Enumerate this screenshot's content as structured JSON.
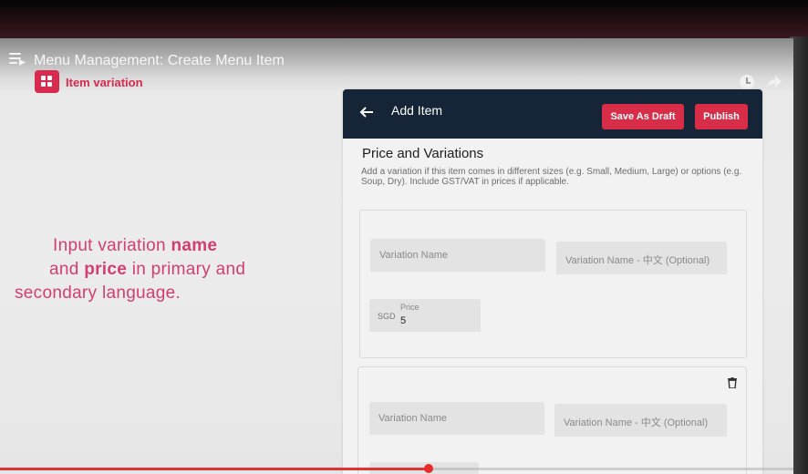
{
  "video": {
    "title": "Menu Management: Create Menu Item",
    "progress_fraction": 0.54
  },
  "brand": {
    "label": "Item variation",
    "accent": "#d8294f"
  },
  "caption": {
    "line1_pre": "Input variation ",
    "line1_bold": "name",
    "line2_pre": "and ",
    "line2_bold": "price",
    "line2_post": " in primary and",
    "line3": "secondary language."
  },
  "card": {
    "title": "Add Item",
    "save_draft_label": "Save As Draft",
    "publish_label": "Publish",
    "section_title": "Price and Variations",
    "section_desc": "Add a variation if this item comes in different sizes (e.g. Small, Medium, Large) or options (e.g. Soup, Dry). Include GST/VAT in prices if applicable.",
    "header_color": "#152436",
    "button_color": "#d72d48"
  },
  "variations": [
    {
      "name_placeholder": "Variation Name",
      "name_cn_placeholder": "Variation Name - 中文 (Optional)",
      "currency": "SGD",
      "price_label": "Price",
      "price_value": "5"
    },
    {
      "name_placeholder": "Variation Name",
      "name_cn_placeholder": "Variation Name - 中文 (Optional)"
    }
  ]
}
